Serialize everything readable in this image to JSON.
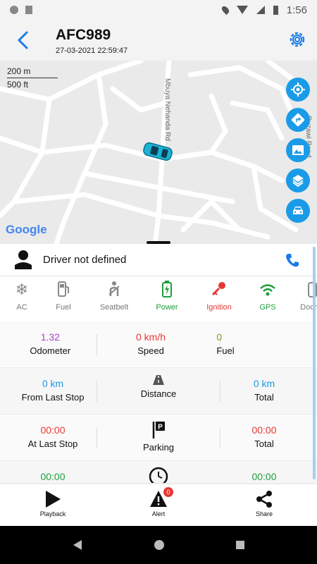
{
  "statusbar": {
    "time": "1:56"
  },
  "header": {
    "title": "AFC989",
    "datetime": "27-03-2021 22:59:47"
  },
  "map": {
    "scale_m": "200 m",
    "scale_ft": "500 ft",
    "road1": "Mbuya Nehanda Rd",
    "road2": "Ruzawi Road",
    "logo": "Google"
  },
  "driver": {
    "label": "Driver not defined"
  },
  "sensors": [
    {
      "label": "AC",
      "color": "#777777",
      "icon": "snowflake-icon"
    },
    {
      "label": "Fuel",
      "color": "#777777",
      "icon": "fuel-pump-icon"
    },
    {
      "label": "Seatbelt",
      "color": "#777777",
      "icon": "seatbelt-icon"
    },
    {
      "label": "Power",
      "color": "#1e9e3a",
      "icon": "battery-icon"
    },
    {
      "label": "Ignition",
      "color": "#e53935",
      "icon": "key-icon"
    },
    {
      "label": "GPS",
      "color": "#1e9e3a",
      "icon": "wifi-icon"
    },
    {
      "label": "Door",
      "color": "#777777",
      "icon": "door-icon"
    }
  ],
  "stats": {
    "odometer": {
      "value": "1.32",
      "label": "Odometer",
      "color": "#b03fd0"
    },
    "speed": {
      "value": "0 km/h",
      "label": "Speed",
      "color": "#e53935"
    },
    "fuel": {
      "value": "0",
      "label": "Fuel",
      "color": "#8a9a1a"
    },
    "from_last_stop": {
      "value": "0 km",
      "label": "From Last Stop",
      "color": "#1a9be8"
    },
    "distance": {
      "label": "Distance"
    },
    "distance_total": {
      "value": "0 km",
      "label": "Total",
      "color": "#1a9be8"
    },
    "at_last_stop": {
      "value": "00:00",
      "label": "At Last Stop",
      "color": "#e53935"
    },
    "parking": {
      "label": "Parking"
    },
    "parking_total": {
      "value": "00:00",
      "label": "Total",
      "color": "#e53935"
    },
    "idle_value": {
      "value": "00:00",
      "color": "#1e9e3a"
    },
    "idle_total": {
      "value": "00:00",
      "color": "#1e9e3a"
    }
  },
  "bottomnav": {
    "playback": "Playback",
    "alert": "Alert",
    "alert_count": "0",
    "share": "Share"
  }
}
